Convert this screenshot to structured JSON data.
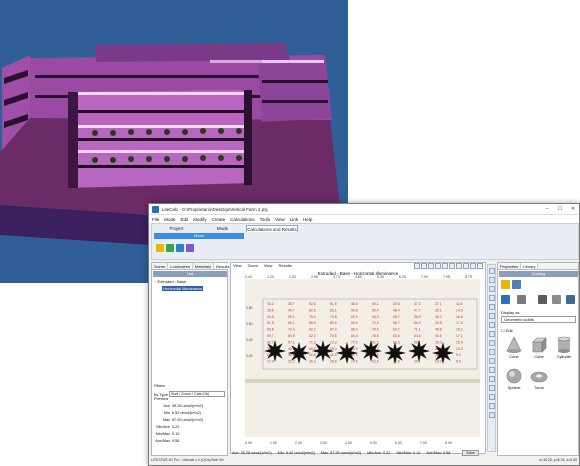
{
  "app": {
    "title": "LiteCalc - D:\\Proprietario\\Desktop\\Vertical Farm 2.psj",
    "window_buttons": {
      "minimize": "–",
      "maximize": "☐",
      "close": "✕"
    }
  },
  "menu": [
    "File",
    "Mode",
    "Edit",
    "Modify",
    "Create",
    "Calculations",
    "Tools",
    "View",
    "Link",
    "Help"
  ],
  "ribbon": {
    "tabs": [
      "Project",
      "Mode",
      "Calculations and Results"
    ],
    "mode_strip": "Mode"
  },
  "left_panel": {
    "tabs": [
      "Scene",
      "Luminaires",
      "Materials",
      "Results"
    ],
    "list_header": "List",
    "tree": [
      {
        "label": "Extruded - Base"
      },
      {
        "label": "Horizontal Illuminance"
      }
    ],
    "filters_label": "Filters",
    "filter_by_label": "by Type",
    "filter_value": "Surf / Zoom / Calc-Obj",
    "preview_label": "Preview",
    "stats": [
      {
        "k": "Ave",
        "v": "39.28 umol/(s*m2)"
      },
      {
        "k": "Min",
        "v": "8.52 umol/(s*m2)"
      },
      {
        "k": "Max",
        "v": "87.99 umol/(s*m2)"
      },
      {
        "k": "Min/Ave",
        "v": "0.22"
      },
      {
        "k": "Min/Max",
        "v": "0.10"
      },
      {
        "k": "Ave/Max",
        "v": "0.58"
      }
    ]
  },
  "main_view": {
    "menu": [
      "View",
      "Zoom",
      "View",
      "Results"
    ],
    "title": "Extruded - Base  -  Horizontal Illuminance",
    "top_ruler": [
      "0.43",
      "1.20",
      "2.00",
      "2.95",
      "3.75",
      "4.50",
      "5.45",
      "6.25",
      "7.00",
      "7.95",
      "8.75"
    ],
    "bottom_ruler": [
      "0.00",
      "1.00",
      "2.00",
      "3.00",
      "4.00",
      "5.00",
      "6.00",
      "7.00",
      "8.00"
    ],
    "left_ruler": [
      "0.80",
      "0.60",
      "0.40",
      "0.20"
    ],
    "value_rows": [
      [
        "33.0",
        "38.7",
        "52.5",
        "51.5",
        "45.0",
        "50.1",
        "39.8",
        "37.0",
        "27.1",
        "11.6"
      ],
      [
        "38.6",
        "49.7",
        "62.6",
        "66.1",
        "59.8",
        "60.4",
        "48.4",
        "47.7",
        "35.1",
        "14.5"
      ],
      [
        "44.8",
        "59.1",
        "78.4",
        "70.8",
        "69.3",
        "63.0",
        "48.7",
        "58.5",
        "48.4",
        "16.6"
      ],
      [
        "51.5",
        "66.1",
        "85.9",
        "86.6",
        "80.6",
        "72.5",
        "58.7",
        "66.9",
        "40.5",
        "17.8"
      ],
      [
        "53.8",
        "70.4",
        "82.2",
        "87.4",
        "88.0",
        "79.6",
        "64.7",
        "71.1",
        "45.8",
        "18.2"
      ],
      [
        "50.7",
        "64.8",
        "82.2",
        "75.5",
        "80.4",
        "76.6",
        "63.6",
        "63.6",
        "44.6",
        "17.1"
      ],
      [
        "42.7",
        "57.1",
        "72.2",
        "72.3",
        "70.6",
        "61.5",
        "53.3",
        "59.1",
        "36.0",
        "15.4"
      ],
      [
        "35.4",
        "45.8",
        "60.5",
        "59.0",
        "54.9",
        "52.3",
        "45.7",
        "46.3",
        "32.0",
        "13.0"
      ],
      [
        "24.4",
        "30.2",
        "40.8",
        "41.5",
        "37.1",
        "34.5",
        "30.0",
        "30.6",
        "21.3",
        "9.3"
      ],
      [
        "17.4",
        "21.2",
        "26.3",
        "26.8",
        "24.5",
        "22.6",
        "19.6",
        "20.1",
        "14.0",
        "8.5"
      ]
    ],
    "status": {
      "ave": "Ave: 39.28  umol/(s*m2)",
      "min": "Min: 8.52  umol/(s*m2)",
      "max": "Max: 87.99  umol/(s*m2)",
      "min_ave": "Min/Ave: 0.22",
      "min_max": "Min/Max: 0.10",
      "ave_max": "Ave/Max: 0.58",
      "solve_button": "Solve"
    }
  },
  "right_panel": {
    "tabs": [
      "Properties",
      "Library"
    ],
    "catalog_header": "Catalog",
    "display_as_label": "Display as",
    "display_as_value": "Geometric solids",
    "edit_label": "Edit",
    "shapes": [
      "Cone",
      "Cube",
      "Cylinder",
      "Sphere",
      "Torus"
    ]
  },
  "status_bar": {
    "left": "LITESTAR 4D Pro - Litecalc v.4     (c)OxyTech Srl",
    "coords": "x=10.22, y=6.76, z=0.00"
  },
  "colors": {
    "ribbon_blue": "#3a8ee6",
    "accent_pink": "#e040c8",
    "sky_blue": "#2f5f96",
    "value_red": "#c0392b"
  }
}
